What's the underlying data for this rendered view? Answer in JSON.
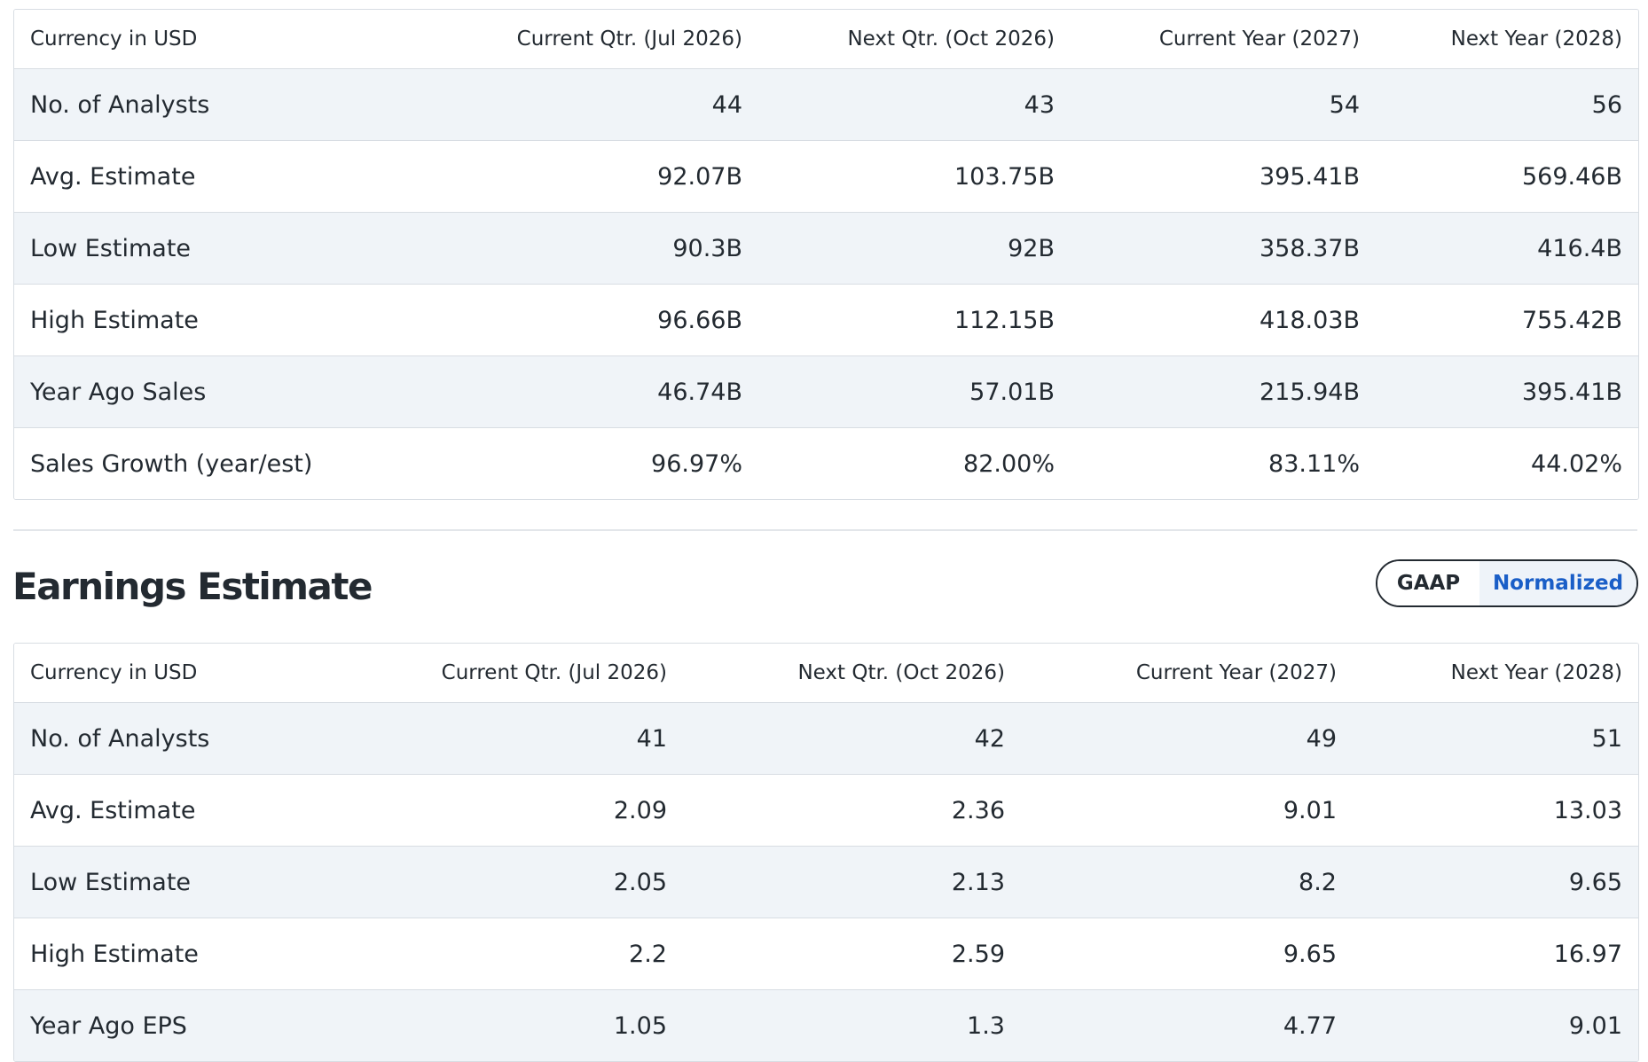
{
  "revenue_estimate": {
    "headers": [
      "Currency in USD",
      "Current Qtr. (Jul 2026)",
      "Next Qtr. (Oct 2026)",
      "Current Year (2027)",
      "Next Year (2028)"
    ],
    "rows": [
      [
        "No. of Analysts",
        "44",
        "43",
        "54",
        "56"
      ],
      [
        "Avg. Estimate",
        "92.07B",
        "103.75B",
        "395.41B",
        "569.46B"
      ],
      [
        "Low Estimate",
        "90.3B",
        "92B",
        "358.37B",
        "416.4B"
      ],
      [
        "High Estimate",
        "96.66B",
        "112.15B",
        "418.03B",
        "755.42B"
      ],
      [
        "Year Ago Sales",
        "46.74B",
        "57.01B",
        "215.94B",
        "395.41B"
      ],
      [
        "Sales Growth (year/est)",
        "96.97%",
        "82.00%",
        "83.11%",
        "44.02%"
      ]
    ]
  },
  "earnings_estimate": {
    "title": "Earnings Estimate",
    "toggle": {
      "options": [
        "GAAP",
        "Normalized"
      ],
      "selected": "Normalized"
    },
    "headers": [
      "Currency in USD",
      "Current Qtr. (Jul 2026)",
      "Next Qtr. (Oct 2026)",
      "Current Year (2027)",
      "Next Year (2028)"
    ],
    "rows": [
      [
        "No. of Analysts",
        "41",
        "42",
        "49",
        "51"
      ],
      [
        "Avg. Estimate",
        "2.09",
        "2.36",
        "9.01",
        "13.03"
      ],
      [
        "Low Estimate",
        "2.05",
        "2.13",
        "8.2",
        "9.65"
      ],
      [
        "High Estimate",
        "2.2",
        "2.59",
        "9.65",
        "16.97"
      ],
      [
        "Year Ago EPS",
        "1.05",
        "1.3",
        "4.77",
        "9.01"
      ]
    ]
  },
  "colors": {
    "text": "#232a31",
    "row_stripe": "#f0f4f8",
    "border": "#d8dde3",
    "toggle_selected_text": "#1a5ec7",
    "toggle_selected_bg": "#eef3f9"
  }
}
